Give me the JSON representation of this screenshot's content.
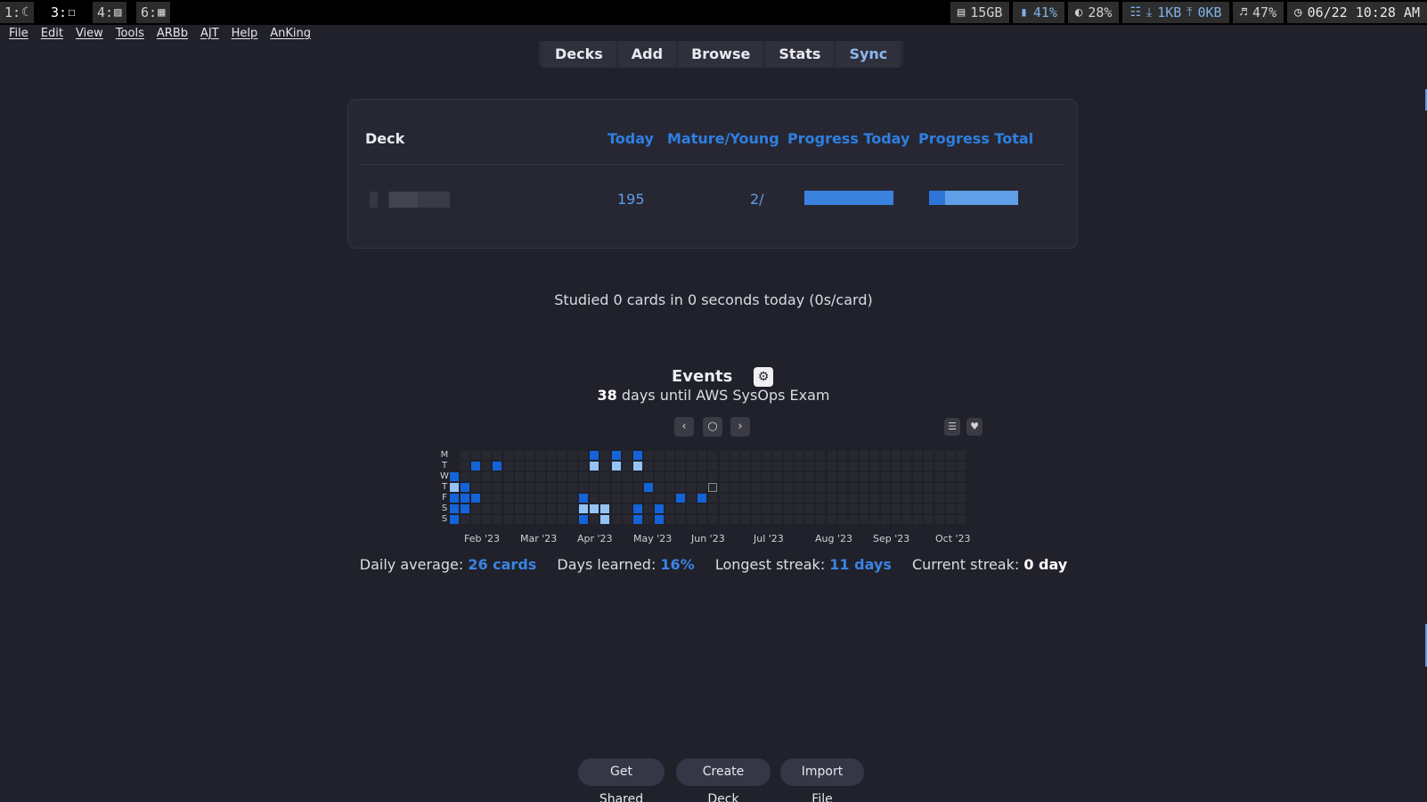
{
  "sysbar": {
    "workspaces": [
      {
        "num": "1:",
        "icon": "moon-icon",
        "glyph": "☾"
      },
      {
        "num": "3:",
        "icon": "document-icon",
        "glyph": "☐"
      },
      {
        "num": "4:",
        "icon": "picture-icon",
        "glyph": "▨"
      },
      {
        "num": "6:",
        "icon": "film-icon",
        "glyph": "▦"
      }
    ],
    "disk": "15GB",
    "memory": "41%",
    "cpu": "28%",
    "net_down": "1KB",
    "net_up": "0KB",
    "volume": "47%",
    "datetime": "06/22 10:28 AM"
  },
  "menu": [
    "File",
    "Edit",
    "View",
    "Tools",
    "ARBb",
    "AJT",
    "Help",
    "AnKing"
  ],
  "nav": [
    "Decks",
    "Add",
    "Browse",
    "Stats",
    "Sync"
  ],
  "deck_table": {
    "headers": {
      "deck": "Deck",
      "today": "Today",
      "mature": "Mature/Young",
      "progress_today": "Progress Today",
      "progress_total": "Progress Total"
    },
    "row": {
      "today": "195",
      "mature_young": "2/",
      "progress_today": 1.0,
      "progress_total": 0.18
    }
  },
  "studied": "Studied 0 cards in 0 seconds today (0s/card)",
  "events": {
    "title": "Events",
    "countdown_days": "38",
    "countdown_text": " days until AWS SysOps Exam"
  },
  "heatmap": {
    "day_labels": [
      "M",
      "T",
      "W",
      "T",
      "F",
      "S",
      "S"
    ],
    "months": [
      "Feb '23",
      "Mar '23",
      "Apr '23",
      "May '23",
      "Jun '23",
      "Jul '23",
      "Aug '23",
      "Sep '23",
      "Oct '23"
    ],
    "colors": {
      "empty": "#272830",
      "low": "#94c3f5",
      "mid": "#3a86e6",
      "high": "#1463d8",
      "today_border": "#8a8a8a"
    }
  },
  "stats": {
    "daily_avg_label": "Daily average: ",
    "daily_avg": "26 cards",
    "days_learned_label": "Days learned: ",
    "days_learned": "16%",
    "longest_label": "Longest streak: ",
    "longest": "11 days",
    "current_label": "Current streak: ",
    "current": "0 day"
  },
  "bottom_buttons": [
    "Get Shared",
    "Create Deck",
    "Import File"
  ]
}
